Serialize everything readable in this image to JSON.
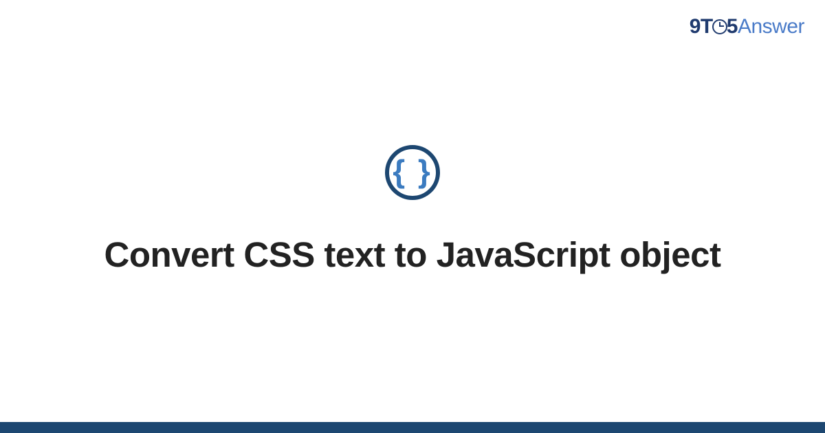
{
  "brand": {
    "part1": "9T",
    "part2": "5",
    "part3": "Answer"
  },
  "icon": {
    "glyph": "{ }",
    "name": "code-braces"
  },
  "title": "Convert CSS text to JavaScript object",
  "colors": {
    "dark_blue": "#1d4771",
    "logo_blue": "#1f3a6e",
    "light_blue": "#4a7bc8",
    "icon_blue": "#3b7bc0",
    "text": "#222222"
  }
}
